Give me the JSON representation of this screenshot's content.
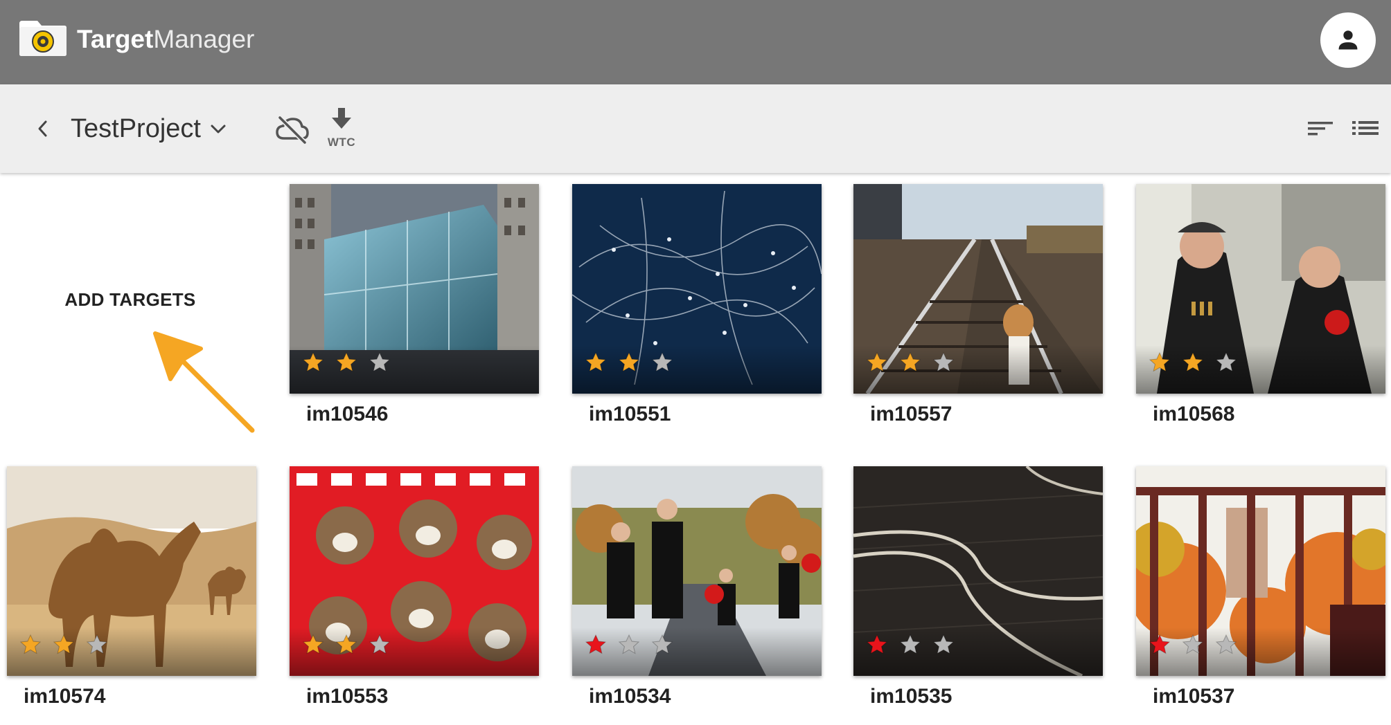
{
  "app": {
    "brand_bold": "Target",
    "brand_light": "Manager"
  },
  "header": {
    "account_icon": "person-icon"
  },
  "toolbar": {
    "project_name": "TestProject",
    "download_label": "WTC",
    "icons": [
      "chevron-left-icon",
      "chevron-down-icon",
      "cloud-off-icon",
      "download-icon",
      "sort-icon",
      "list-view-icon"
    ]
  },
  "main": {
    "add_targets_label": "ADD TARGETS",
    "targets": [
      {
        "name": "im10546",
        "rating": 2,
        "rating_color": "#f5a623"
      },
      {
        "name": "im10551",
        "rating": 2,
        "rating_color": "#f5a623"
      },
      {
        "name": "im10557",
        "rating": 2,
        "rating_color": "#f5a623"
      },
      {
        "name": "im10568",
        "rating": 2,
        "rating_color": "#f5a623"
      },
      {
        "name": "im10574",
        "rating": 2,
        "rating_color": "#f5a623"
      },
      {
        "name": "im10553",
        "rating": 2,
        "rating_color": "#f5a623"
      },
      {
        "name": "im10534",
        "rating": 1,
        "rating_color": "#e8141b"
      },
      {
        "name": "im10535",
        "rating": 1,
        "rating_color": "#e8141b"
      },
      {
        "name": "im10537",
        "rating": 1,
        "rating_color": "#e8141b"
      }
    ],
    "max_rating": 3
  },
  "colors": {
    "appbar": "#777777",
    "toolbar": "#eeeeee",
    "hint_arrow": "#f5a623",
    "star_empty": "#b8b8b8"
  }
}
